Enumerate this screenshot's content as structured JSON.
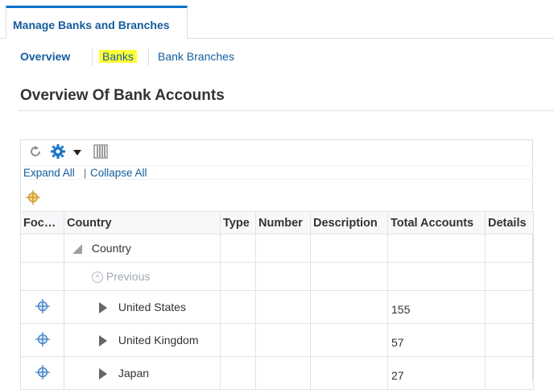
{
  "tab": {
    "label": "Manage Banks and Branches"
  },
  "subnav": {
    "overview": "Overview",
    "banks": "Banks",
    "branches": "Bank Branches"
  },
  "page_title": "Overview Of Bank Accounts",
  "toolbar": {
    "refresh_icon": "refresh-icon",
    "settings_icon": "gear-icon",
    "columns_icon": "columns-icon"
  },
  "links": {
    "expand_all": "Expand All",
    "separator": "|",
    "collapse_all": "Collapse All"
  },
  "table": {
    "columns": [
      "Foc…",
      "Country",
      "Type",
      "Number",
      "Description",
      "Total Accounts",
      "Details"
    ],
    "root_label": "Country",
    "previous_label": "Previous",
    "rows": [
      {
        "country": "United States",
        "total": "155"
      },
      {
        "country": "United Kingdom",
        "total": "57"
      },
      {
        "country": "Japan",
        "total": "27"
      }
    ]
  },
  "colors": {
    "accent": "#0572ce",
    "link": "#145c9e",
    "highlight": "#ffff38"
  }
}
